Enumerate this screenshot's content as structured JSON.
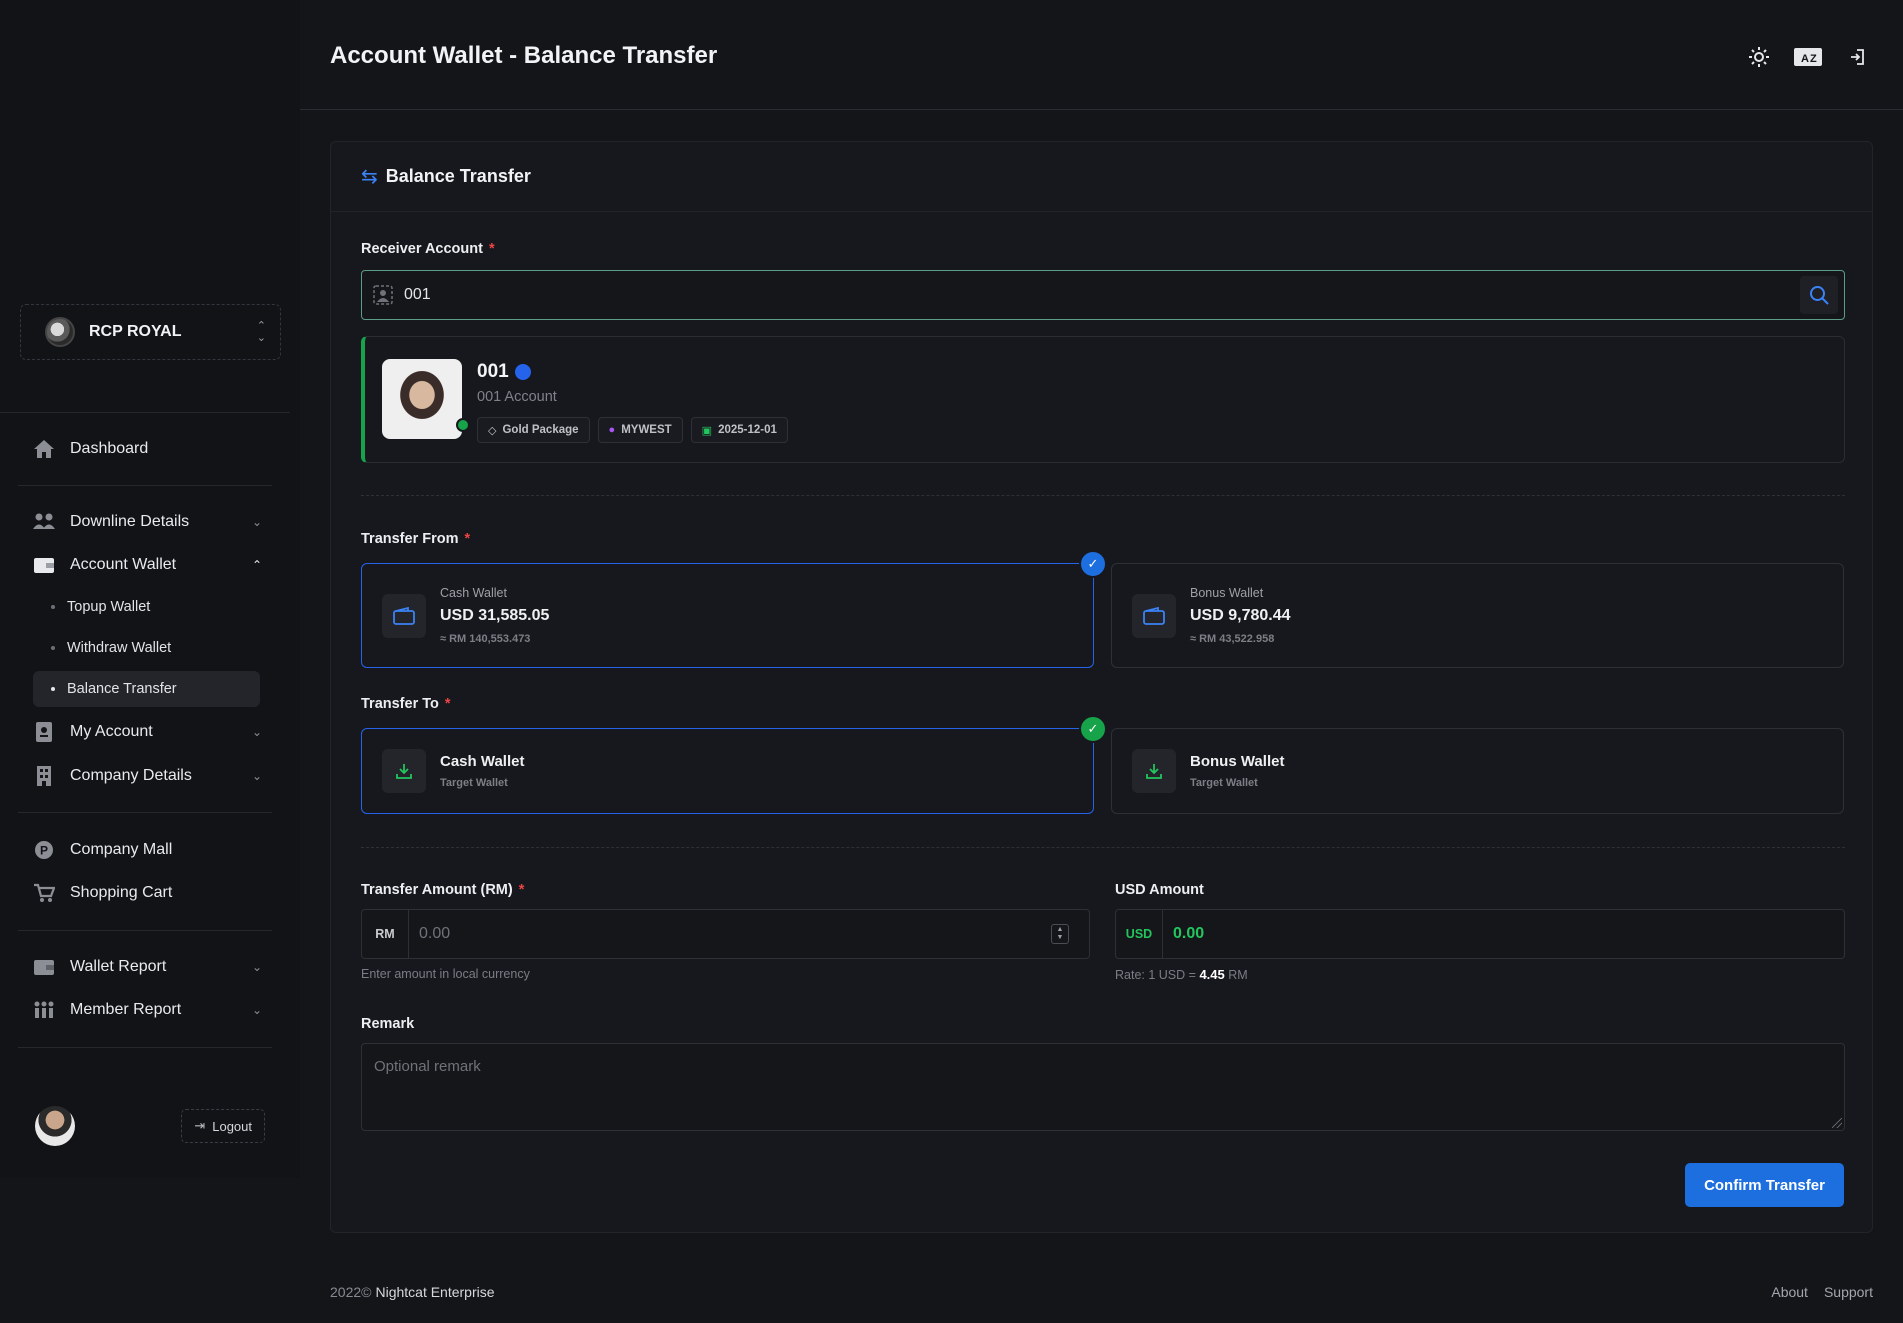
{
  "header": {
    "title": "Account Wallet - Balance Transfer"
  },
  "sidebar": {
    "brand": "RCP ROYAL",
    "items": [
      {
        "label": "Dashboard",
        "icon": "home-icon"
      },
      {
        "label": "Downline Details",
        "icon": "users-icon"
      },
      {
        "label": "Account Wallet",
        "icon": "wallet-icon"
      },
      {
        "label": "My Account",
        "icon": "id-card-icon"
      },
      {
        "label": "Company Details",
        "icon": "building-icon"
      },
      {
        "label": "Company Mall",
        "icon": "mall-icon"
      },
      {
        "label": "Shopping Cart",
        "icon": "cart-icon"
      },
      {
        "label": "Wallet Report",
        "icon": "wallet-report-icon"
      },
      {
        "label": "Member Report",
        "icon": "member-report-icon"
      }
    ],
    "sub_items": [
      "Topup Wallet",
      "Withdraw Wallet",
      "Balance Transfer"
    ],
    "logout": "Logout"
  },
  "card": {
    "title": "Balance Transfer"
  },
  "receiver": {
    "label": "Receiver Account",
    "required": "*",
    "value": "001"
  },
  "account": {
    "id": "001",
    "name": "001 Account",
    "tags": [
      "Gold Package",
      "MYWEST",
      "2025-12-01"
    ]
  },
  "transfer_from": {
    "label": "Transfer From",
    "wallets": [
      {
        "name": "Cash Wallet",
        "amount": "USD 31,585.05",
        "local": "≈ RM 140,553.473"
      },
      {
        "name": "Bonus Wallet",
        "amount": "USD 9,780.44",
        "local": "≈ RM 43,522.958"
      }
    ]
  },
  "transfer_to": {
    "label": "Transfer To",
    "wallets": [
      {
        "name": "Cash Wallet",
        "sub": "Target Wallet"
      },
      {
        "name": "Bonus Wallet",
        "sub": "Target Wallet"
      }
    ]
  },
  "amount": {
    "label": "Transfer Amount (RM)",
    "prefix": "RM",
    "placeholder": "0.00",
    "hint": "Enter amount in local currency"
  },
  "usd": {
    "label": "USD Amount",
    "prefix": "USD",
    "value": "0.00",
    "rate_prefix": "Rate: 1 USD =",
    "rate_value": "4.45",
    "rate_unit": "RM"
  },
  "remark": {
    "label": "Remark",
    "placeholder": "Optional remark"
  },
  "confirm_label": "Confirm Transfer",
  "footer": {
    "year": "2022©",
    "company": "Nightcat Enterprise",
    "links": [
      "About",
      "Support"
    ]
  },
  "colors": {
    "primary": "#1d6fe0",
    "success": "#16a34a",
    "usd_value": "#22c55e"
  }
}
